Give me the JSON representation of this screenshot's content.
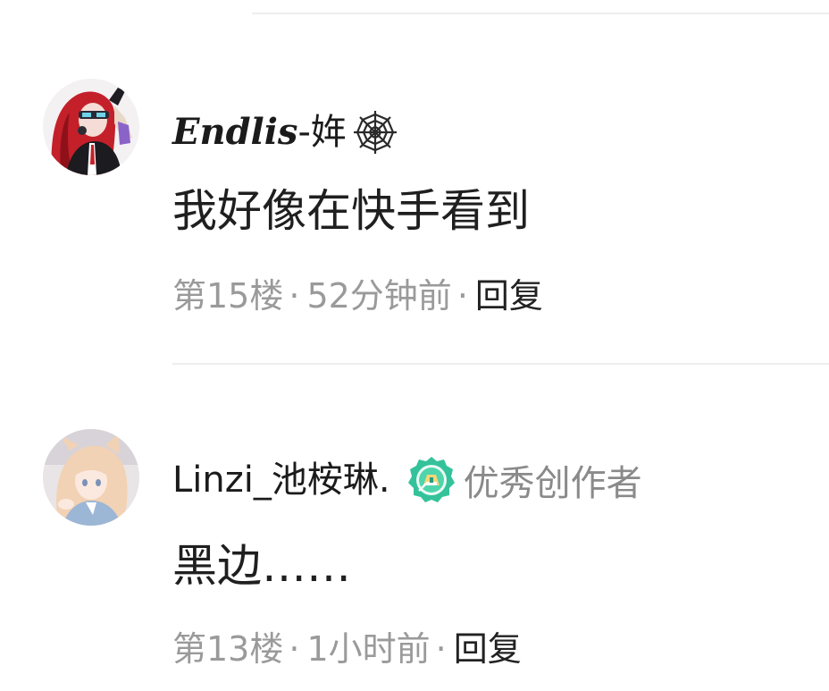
{
  "comments": [
    {
      "username_latin": "Endlis",
      "username_suffix": "-姩",
      "user_icon": "spider-web-icon",
      "text": "我好像在快手看到",
      "floor": "第15楼",
      "time": "52分钟前",
      "reply_label": "回复"
    },
    {
      "username": "Linzi_池桉琳.",
      "badge_icon": "medal-icon",
      "badge_label": "优秀创作者",
      "text": "黑边……",
      "floor": "第13楼",
      "time": "1小时前",
      "reply_label": "回复"
    }
  ],
  "separator": "·",
  "colors": {
    "meta_text": "#9a9a9a",
    "badge_green": "#2fbf8f",
    "divider": "#eeeeee"
  }
}
